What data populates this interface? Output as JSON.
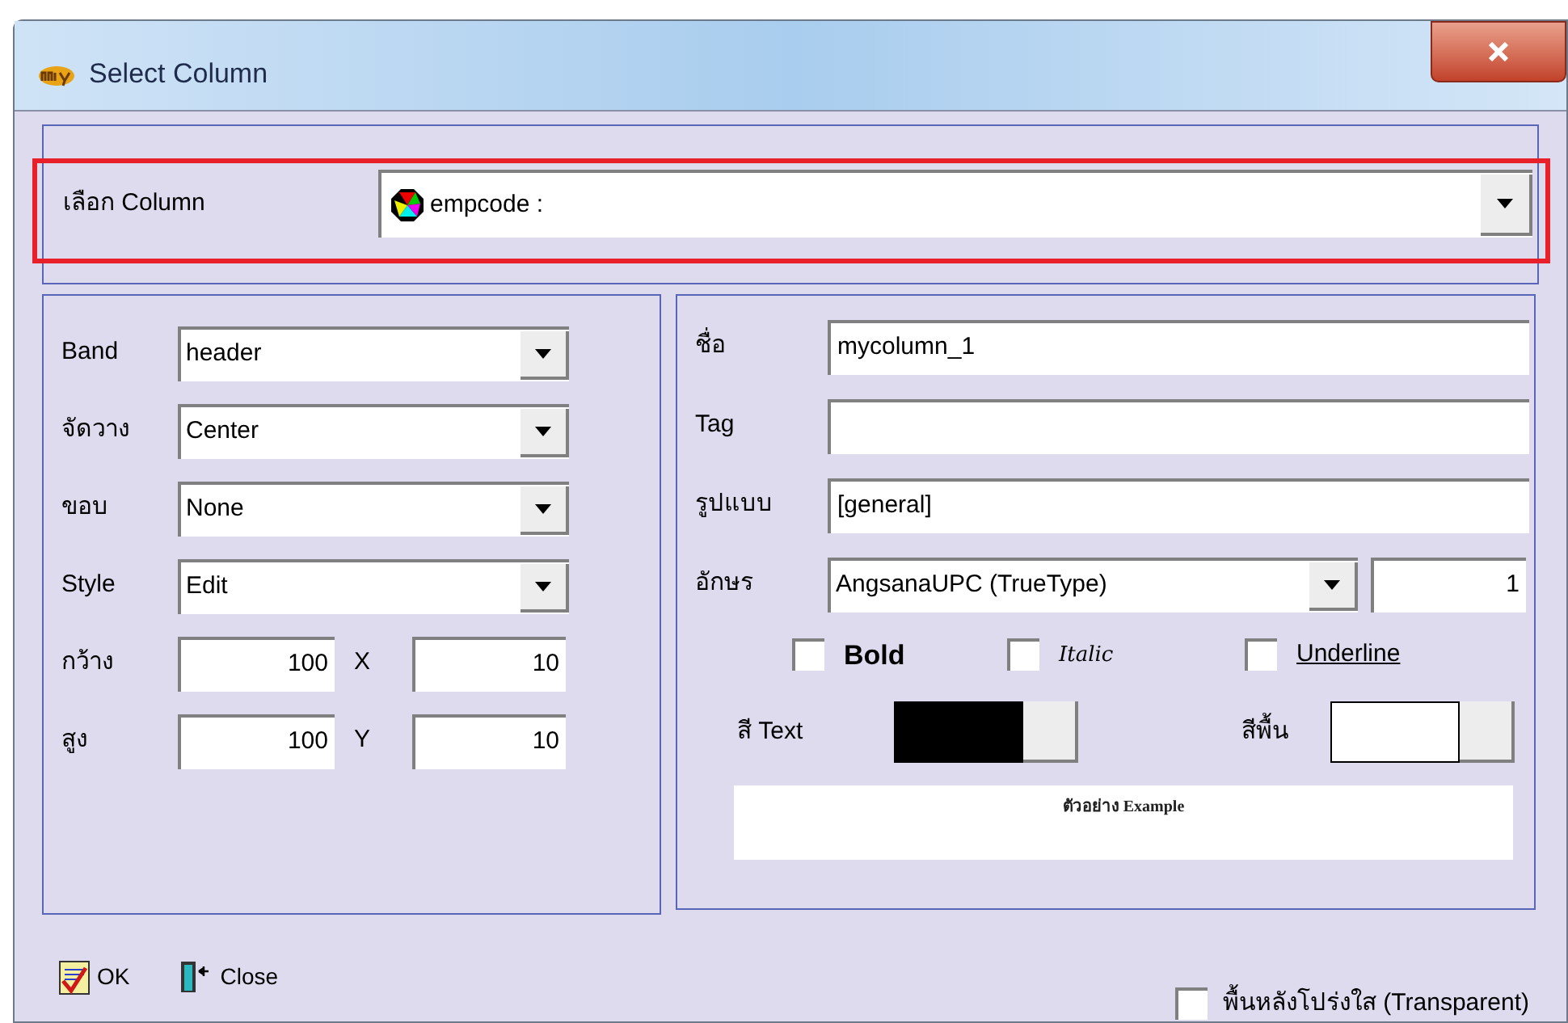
{
  "window": {
    "title": "Select Column"
  },
  "column_select": {
    "label": "เลือก Column",
    "value": "empcode :",
    "highlighted": true
  },
  "layout_fields": [
    {
      "kind": "combo",
      "label": "Band",
      "value": "header"
    },
    {
      "kind": "combo",
      "label": "จัดวาง",
      "value": "Center"
    },
    {
      "kind": "combo",
      "label": "ขอบ",
      "value": "None"
    },
    {
      "kind": "combo",
      "label": "Style",
      "value": "Edit"
    },
    {
      "kind": "pair",
      "label": "กว้าง",
      "value": "100",
      "axis": "X",
      "axis_value": "10"
    },
    {
      "kind": "pair",
      "label": "สูง",
      "value": "100",
      "axis": "Y",
      "axis_value": "10"
    }
  ],
  "text_fields": [
    {
      "kind": "text",
      "label": "ชื่อ",
      "value": "mycolumn_1"
    },
    {
      "kind": "text",
      "label": "Tag"
    },
    {
      "kind": "text",
      "label": "รูปแบบ",
      "value": "[general]"
    },
    {
      "kind": "font",
      "label": "อักษร",
      "value": "AngsanaUPC (TrueType)",
      "size": "1"
    }
  ],
  "styles": [
    {
      "kind": "bold",
      "label": "Bold",
      "checked": false
    },
    {
      "kind": "italic",
      "label": "Italic",
      "checked": false
    },
    {
      "kind": "underline",
      "label": "Underline",
      "checked": false
    }
  ],
  "colors": [
    {
      "label": "สี Text",
      "color": "#000000"
    },
    {
      "label": "สีพื้น",
      "color": "#ffffff"
    }
  ],
  "preview": {
    "text": "ตัวอย่าง Example"
  },
  "buttons": [
    {
      "kind": "ok",
      "label": "OK"
    },
    {
      "kind": "close",
      "label": "Close"
    }
  ],
  "transparent": {
    "label": "พื้นหลังโปร่งใส (Transparent)",
    "checked": false
  }
}
